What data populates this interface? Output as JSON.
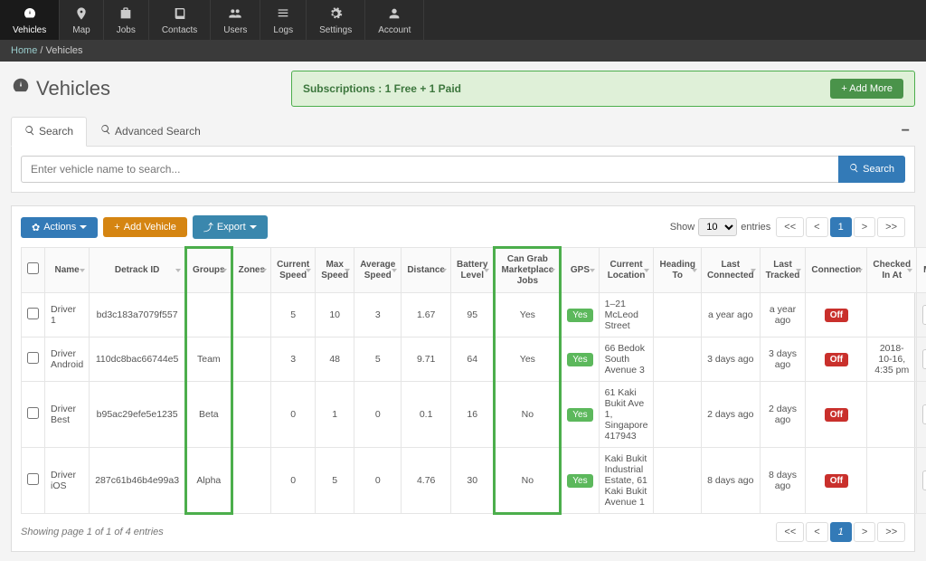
{
  "nav": {
    "items": [
      {
        "label": "Vehicles",
        "icon": "gauge"
      },
      {
        "label": "Map",
        "icon": "pin"
      },
      {
        "label": "Jobs",
        "icon": "briefcase"
      },
      {
        "label": "Contacts",
        "icon": "book"
      },
      {
        "label": "Users",
        "icon": "users"
      },
      {
        "label": "Logs",
        "icon": "list"
      },
      {
        "label": "Settings",
        "icon": "gear"
      },
      {
        "label": "Account",
        "icon": "user"
      }
    ],
    "active": 0
  },
  "breadcrumb": {
    "home": "Home",
    "sep": "/",
    "current": "Vehicles"
  },
  "page": {
    "title": "Vehicles"
  },
  "subscription": {
    "text": "Subscriptions : 1 Free + 1 Paid",
    "add_more": "+ Add More"
  },
  "tabs": {
    "search": "Search",
    "advanced": "Advanced Search"
  },
  "search": {
    "placeholder": "Enter vehicle name to search...",
    "button": "Search"
  },
  "toolbar": {
    "actions": "Actions",
    "add_vehicle": "Add Vehicle",
    "export": "Export",
    "show": "Show",
    "entries": "entries",
    "page_size": "10"
  },
  "pager": {
    "first": "<<",
    "prev": "<",
    "page": "1",
    "next": ">",
    "last": ">>"
  },
  "columns": [
    "",
    "Name",
    "Detrack ID",
    "Groups",
    "Zones",
    "Current Speed",
    "Max Speed",
    "Average Speed",
    "Distance",
    "Battery Level",
    "Can Grab Marketplace Jobs",
    "GPS",
    "Current Location",
    "Heading To",
    "Last Connected",
    "Last Tracked",
    "Connection",
    "Checked In At",
    "Map"
  ],
  "rows": [
    {
      "name": "Driver 1",
      "detrack": "bd3c183a7079f557",
      "groups": "",
      "zones": "",
      "cur": "5",
      "max": "10",
      "avg": "3",
      "dist": "1.67",
      "batt": "95",
      "grab": "Yes",
      "gps": "Yes",
      "loc": "1–21 McLeod Street",
      "heading": "",
      "lastc": "a year ago",
      "lastt": "a year ago",
      "conn": "Off",
      "checkin": ""
    },
    {
      "name": "Driver Android",
      "detrack": "110dc8bac66744e5",
      "groups": "Team",
      "zones": "",
      "cur": "3",
      "max": "48",
      "avg": "5",
      "dist": "9.71",
      "batt": "64",
      "grab": "Yes",
      "gps": "Yes",
      "loc": "66 Bedok South Avenue 3",
      "heading": "",
      "lastc": "3 days ago",
      "lastt": "3 days ago",
      "conn": "Off",
      "checkin": "2018-10-16, 4:35 pm"
    },
    {
      "name": "Driver Best",
      "detrack": "b95ac29efe5e1235",
      "groups": "Beta",
      "zones": "",
      "cur": "0",
      "max": "1",
      "avg": "0",
      "dist": "0.1",
      "batt": "16",
      "grab": "No",
      "gps": "Yes",
      "loc": "61 Kaki Bukit Ave 1, Singapore 417943",
      "heading": "",
      "lastc": "2 days ago",
      "lastt": "2 days ago",
      "conn": "Off",
      "checkin": ""
    },
    {
      "name": "Driver iOS",
      "detrack": "287c61b46b4e99a3",
      "groups": "Alpha",
      "zones": "",
      "cur": "0",
      "max": "5",
      "avg": "0",
      "dist": "4.76",
      "batt": "30",
      "grab": "No",
      "gps": "Yes",
      "loc": "Kaki Bukit Industrial Estate, 61 Kaki Bukit Avenue 1",
      "heading": "",
      "lastc": "8 days ago",
      "lastt": "8 days ago",
      "conn": "Off",
      "checkin": ""
    }
  ],
  "footer": {
    "info": "Showing page 1 of 1 of 4 entries"
  }
}
